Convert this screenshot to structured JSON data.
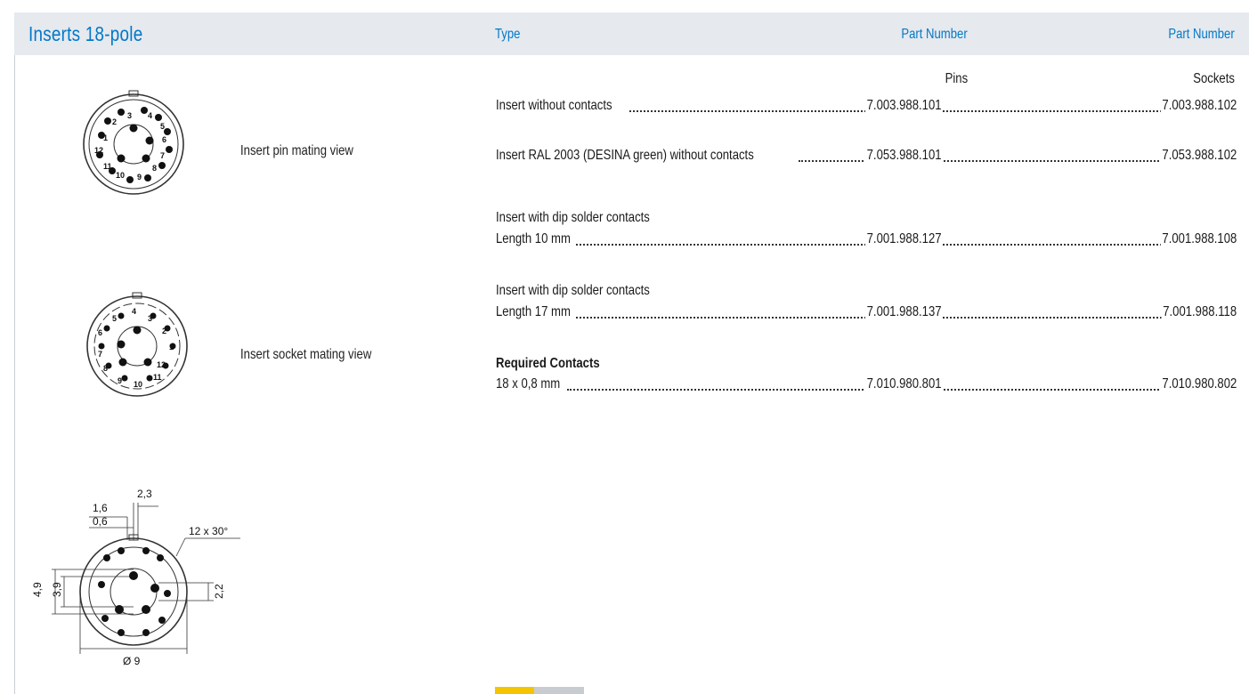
{
  "header": {
    "title": "Inserts 18-pole",
    "col_type": "Type",
    "col_part_number_1": "Part Number",
    "col_part_number_2": "Part Number"
  },
  "subheaders": {
    "pins": "Pins",
    "sockets": "Sockets"
  },
  "views": {
    "pin_label": "Insert pin mating view",
    "socket_label": "Insert socket mating view",
    "pin_numbers": [
      "1",
      "2",
      "3",
      "4",
      "5",
      "6",
      "7",
      "8",
      "9",
      "10",
      "11",
      "12"
    ],
    "socket_numbers": [
      "1",
      "2",
      "3",
      "4",
      "5",
      "6",
      "7",
      "8",
      "9",
      "10",
      "11",
      "12"
    ]
  },
  "dimensions": {
    "d1": "2,3",
    "d2": "1,6",
    "d3": "0,6",
    "angle": "12 x 30°",
    "d4": "4,9",
    "d5": "3,9",
    "d6": "2,2",
    "diameter": "Ø 9"
  },
  "rows": [
    {
      "prefix": "",
      "description": "Insert without contacts",
      "pins": "7.003.988.101",
      "sockets": "7.003.988.102"
    },
    {
      "prefix": "",
      "description": "Insert RAL 2003 (DESINA green) without contacts",
      "pins": "7.053.988.101",
      "sockets": "7.053.988.102"
    },
    {
      "prefix": "Insert with dip solder contacts",
      "description": "Length 10 mm",
      "pins": "7.001.988.127",
      "sockets": "7.001.988.108"
    },
    {
      "prefix": "Insert with dip solder contacts",
      "description": "Length 17 mm",
      "pins": "7.001.988.137",
      "sockets": "7.001.988.118"
    },
    {
      "prefix": "Required Contacts",
      "description": "18 x 0,8 mm",
      "pins": "7.010.980.801",
      "sockets": "7.010.980.802"
    }
  ],
  "colors": {
    "accent": "#0078c8",
    "header_bg": "#e6e9ee",
    "chip_yellow": "#f5c400",
    "chip_gray": "#c8cbd0"
  }
}
